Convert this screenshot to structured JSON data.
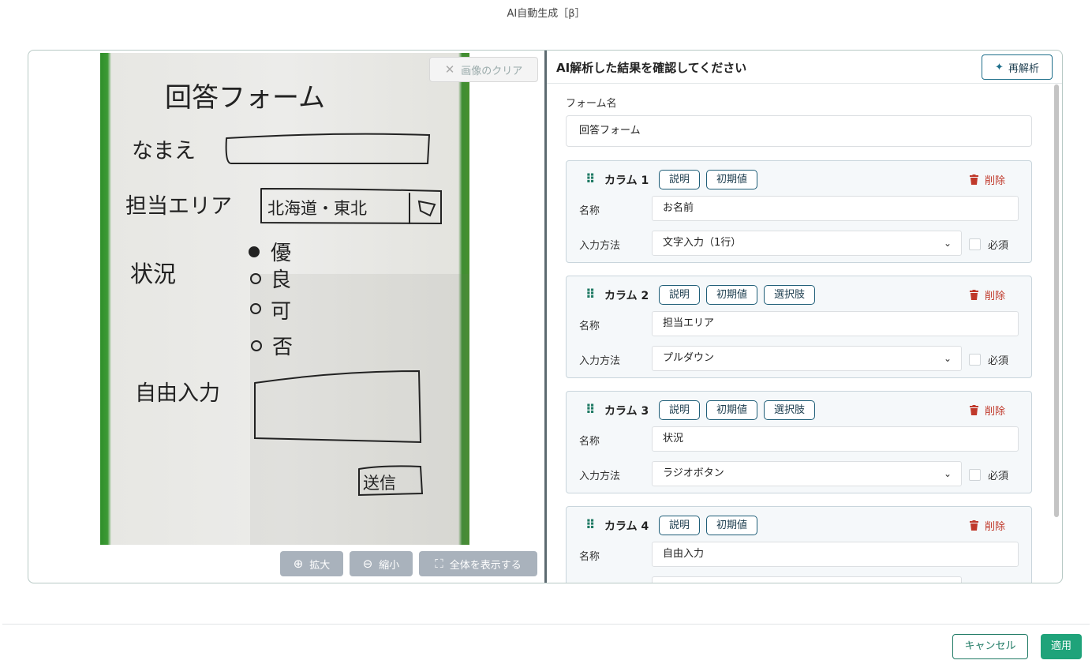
{
  "modal": {
    "title": "AI自動生成［β］"
  },
  "viewer": {
    "clear_label": "画像のクリア",
    "zoom_in_label": "拡大",
    "zoom_out_label": "縮小",
    "fit_label": "全体を表示する",
    "photo_text": {
      "title": "回答フォーム",
      "name": "なまえ",
      "area": "担当エリア",
      "area_value": "北海道・東北",
      "status": "状況",
      "options": [
        "優",
        "良",
        "可",
        "否"
      ],
      "free": "自由入力",
      "submit": "送信"
    }
  },
  "results": {
    "title": "AI解析した結果を確認してください",
    "reanalyze_label": "再解析",
    "form_name_label": "フォーム名",
    "form_name_value": "回答フォーム",
    "labels": {
      "name": "名称",
      "input_method": "入力方法",
      "required": "必須",
      "delete": "削除"
    },
    "columns": [
      {
        "title": "カラム 1",
        "chips": [
          "説明",
          "初期値"
        ],
        "name": "お名前",
        "input_method": "文字入力（1行）"
      },
      {
        "title": "カラム 2",
        "chips": [
          "説明",
          "初期値",
          "選択肢"
        ],
        "name": "担当エリア",
        "input_method": "プルダウン"
      },
      {
        "title": "カラム 3",
        "chips": [
          "説明",
          "初期値",
          "選択肢"
        ],
        "name": "状況",
        "input_method": "ラジオボタン"
      },
      {
        "title": "カラム 4",
        "chips": [
          "説明",
          "初期値"
        ],
        "name": "自由入力",
        "input_method": ""
      }
    ]
  },
  "footer": {
    "cancel_label": "キャンセル",
    "apply_label": "適用"
  },
  "colors": {
    "accent": "#1fa37a",
    "danger": "#c0392b",
    "chip_border": "#1f5e78"
  }
}
